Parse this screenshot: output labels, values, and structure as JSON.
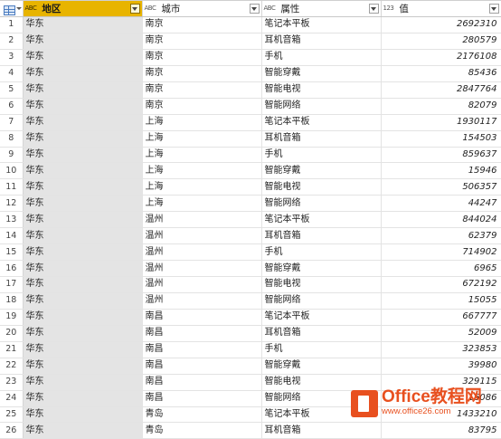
{
  "columns": [
    {
      "type_icon": "ABC",
      "name": "地区",
      "selected": true
    },
    {
      "type_icon": "ABC",
      "name": "城市",
      "selected": false
    },
    {
      "type_icon": "ABC",
      "name": "属性",
      "selected": false
    },
    {
      "type_icon": "123",
      "name": "值",
      "selected": false
    }
  ],
  "rows": [
    {
      "idx": "1",
      "region": "华东",
      "city": "南京",
      "attr": "笔记本平板",
      "value": "2692310"
    },
    {
      "idx": "2",
      "region": "华东",
      "city": "南京",
      "attr": "耳机音箱",
      "value": "280579"
    },
    {
      "idx": "3",
      "region": "华东",
      "city": "南京",
      "attr": "手机",
      "value": "2176108"
    },
    {
      "idx": "4",
      "region": "华东",
      "city": "南京",
      "attr": "智能穿戴",
      "value": "85436"
    },
    {
      "idx": "5",
      "region": "华东",
      "city": "南京",
      "attr": "智能电视",
      "value": "2847764"
    },
    {
      "idx": "6",
      "region": "华东",
      "city": "南京",
      "attr": "智能网络",
      "value": "82079"
    },
    {
      "idx": "7",
      "region": "华东",
      "city": "上海",
      "attr": "笔记本平板",
      "value": "1930117"
    },
    {
      "idx": "8",
      "region": "华东",
      "city": "上海",
      "attr": "耳机音箱",
      "value": "154503"
    },
    {
      "idx": "9",
      "region": "华东",
      "city": "上海",
      "attr": "手机",
      "value": "859637"
    },
    {
      "idx": "10",
      "region": "华东",
      "city": "上海",
      "attr": "智能穿戴",
      "value": "15946"
    },
    {
      "idx": "11",
      "region": "华东",
      "city": "上海",
      "attr": "智能电视",
      "value": "506357"
    },
    {
      "idx": "12",
      "region": "华东",
      "city": "上海",
      "attr": "智能网络",
      "value": "44247"
    },
    {
      "idx": "13",
      "region": "华东",
      "city": "温州",
      "attr": "笔记本平板",
      "value": "844024"
    },
    {
      "idx": "14",
      "region": "华东",
      "city": "温州",
      "attr": "耳机音箱",
      "value": "62379"
    },
    {
      "idx": "15",
      "region": "华东",
      "city": "温州",
      "attr": "手机",
      "value": "714902"
    },
    {
      "idx": "16",
      "region": "华东",
      "city": "温州",
      "attr": "智能穿戴",
      "value": "6965"
    },
    {
      "idx": "17",
      "region": "华东",
      "city": "温州",
      "attr": "智能电视",
      "value": "672192"
    },
    {
      "idx": "18",
      "region": "华东",
      "city": "温州",
      "attr": "智能网络",
      "value": "15055"
    },
    {
      "idx": "19",
      "region": "华东",
      "city": "南昌",
      "attr": "笔记本平板",
      "value": "667777"
    },
    {
      "idx": "20",
      "region": "华东",
      "city": "南昌",
      "attr": "耳机音箱",
      "value": "52009"
    },
    {
      "idx": "21",
      "region": "华东",
      "city": "南昌",
      "attr": "手机",
      "value": "323853"
    },
    {
      "idx": "22",
      "region": "华东",
      "city": "南昌",
      "attr": "智能穿戴",
      "value": "39980"
    },
    {
      "idx": "23",
      "region": "华东",
      "city": "南昌",
      "attr": "智能电视",
      "value": "329115"
    },
    {
      "idx": "24",
      "region": "华东",
      "city": "南昌",
      "attr": "智能网络",
      "value": "16086"
    },
    {
      "idx": "25",
      "region": "华东",
      "city": "青岛",
      "attr": "笔记本平板",
      "value": "1433210"
    },
    {
      "idx": "26",
      "region": "华东",
      "city": "青岛",
      "attr": "耳机音箱",
      "value": "83795"
    }
  ],
  "watermark": {
    "brand": "Office教程网",
    "site": "www.office26.com"
  },
  "colors": {
    "selected_header": "#e8b400",
    "region_column": "#e4e4e4",
    "watermark": "#e8501f"
  }
}
